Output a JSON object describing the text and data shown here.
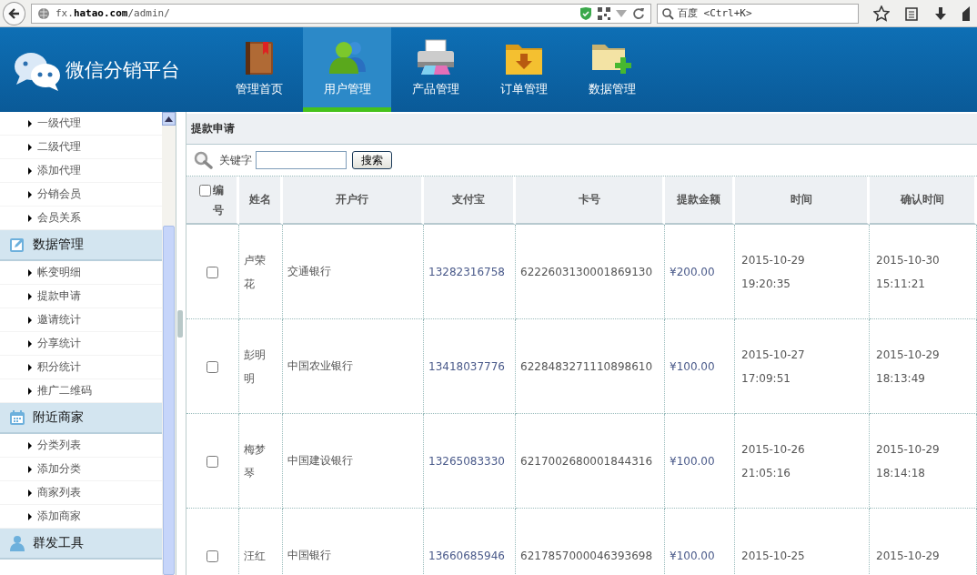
{
  "browser": {
    "url": "fx.**hatao.com**/admin/",
    "search_placeholder": "百度 <Ctrl+K>"
  },
  "header": {
    "logo": "微信分销平台",
    "nav": [
      {
        "label": "管理首页",
        "selected": false
      },
      {
        "label": "用户管理",
        "selected": true
      },
      {
        "label": "产品管理",
        "selected": false
      },
      {
        "label": "订单管理",
        "selected": false
      },
      {
        "label": "数据管理",
        "selected": false
      }
    ]
  },
  "sidebar": {
    "groups": [
      {
        "items": [
          "一级代理",
          "二级代理",
          "添加代理",
          "分销会员",
          "会员关系"
        ]
      },
      {
        "title": "数据管理",
        "items": [
          "帐变明细",
          "提款申请",
          "邀请统计",
          "分享统计",
          "积分统计",
          "推广二维码"
        ]
      },
      {
        "title": "附近商家",
        "items": [
          "分类列表",
          "添加分类",
          "商家列表",
          "添加商家"
        ]
      },
      {
        "title": "群发工具"
      }
    ]
  },
  "panel": {
    "title": "提款申请",
    "search_label": "关键字",
    "search_button": "搜索"
  },
  "table": {
    "select_all": {
      "checked": false
    },
    "columns": [
      "编号",
      "姓名",
      "开户行",
      "支付宝",
      "卡号",
      "提款金额",
      "时间",
      "确认时间"
    ],
    "rows": [
      {
        "checked": false,
        "name": "卢荣花",
        "bank": "交通银行",
        "alipay": "13282316758",
        "card": "6222603130001869130",
        "amount": "¥200.00",
        "time": "2015-10-29 19:20:35",
        "confirm_time": "2015-10-30 15:11:21"
      },
      {
        "checked": false,
        "name": "彭明明",
        "bank": "中国农业银行",
        "alipay": "13418037776",
        "card": "6228483271110898610",
        "amount": "¥100.00",
        "time": "2015-10-27 17:09:51",
        "confirm_time": "2015-10-29 18:13:49"
      },
      {
        "checked": false,
        "name": "梅梦琴",
        "bank": "中国建设银行",
        "alipay": "13265083330",
        "card": "6217002680001844316",
        "amount": "¥100.00",
        "time": "2015-10-26 21:05:16",
        "confirm_time": "2015-10-29 18:14:18"
      },
      {
        "checked": false,
        "name": "汪红",
        "bank": "中国银行",
        "alipay": "13660685946",
        "card": "6217857000046393698",
        "amount": "¥100.00",
        "time": "2015-10-25",
        "confirm_time": "2015-10-29"
      }
    ]
  }
}
